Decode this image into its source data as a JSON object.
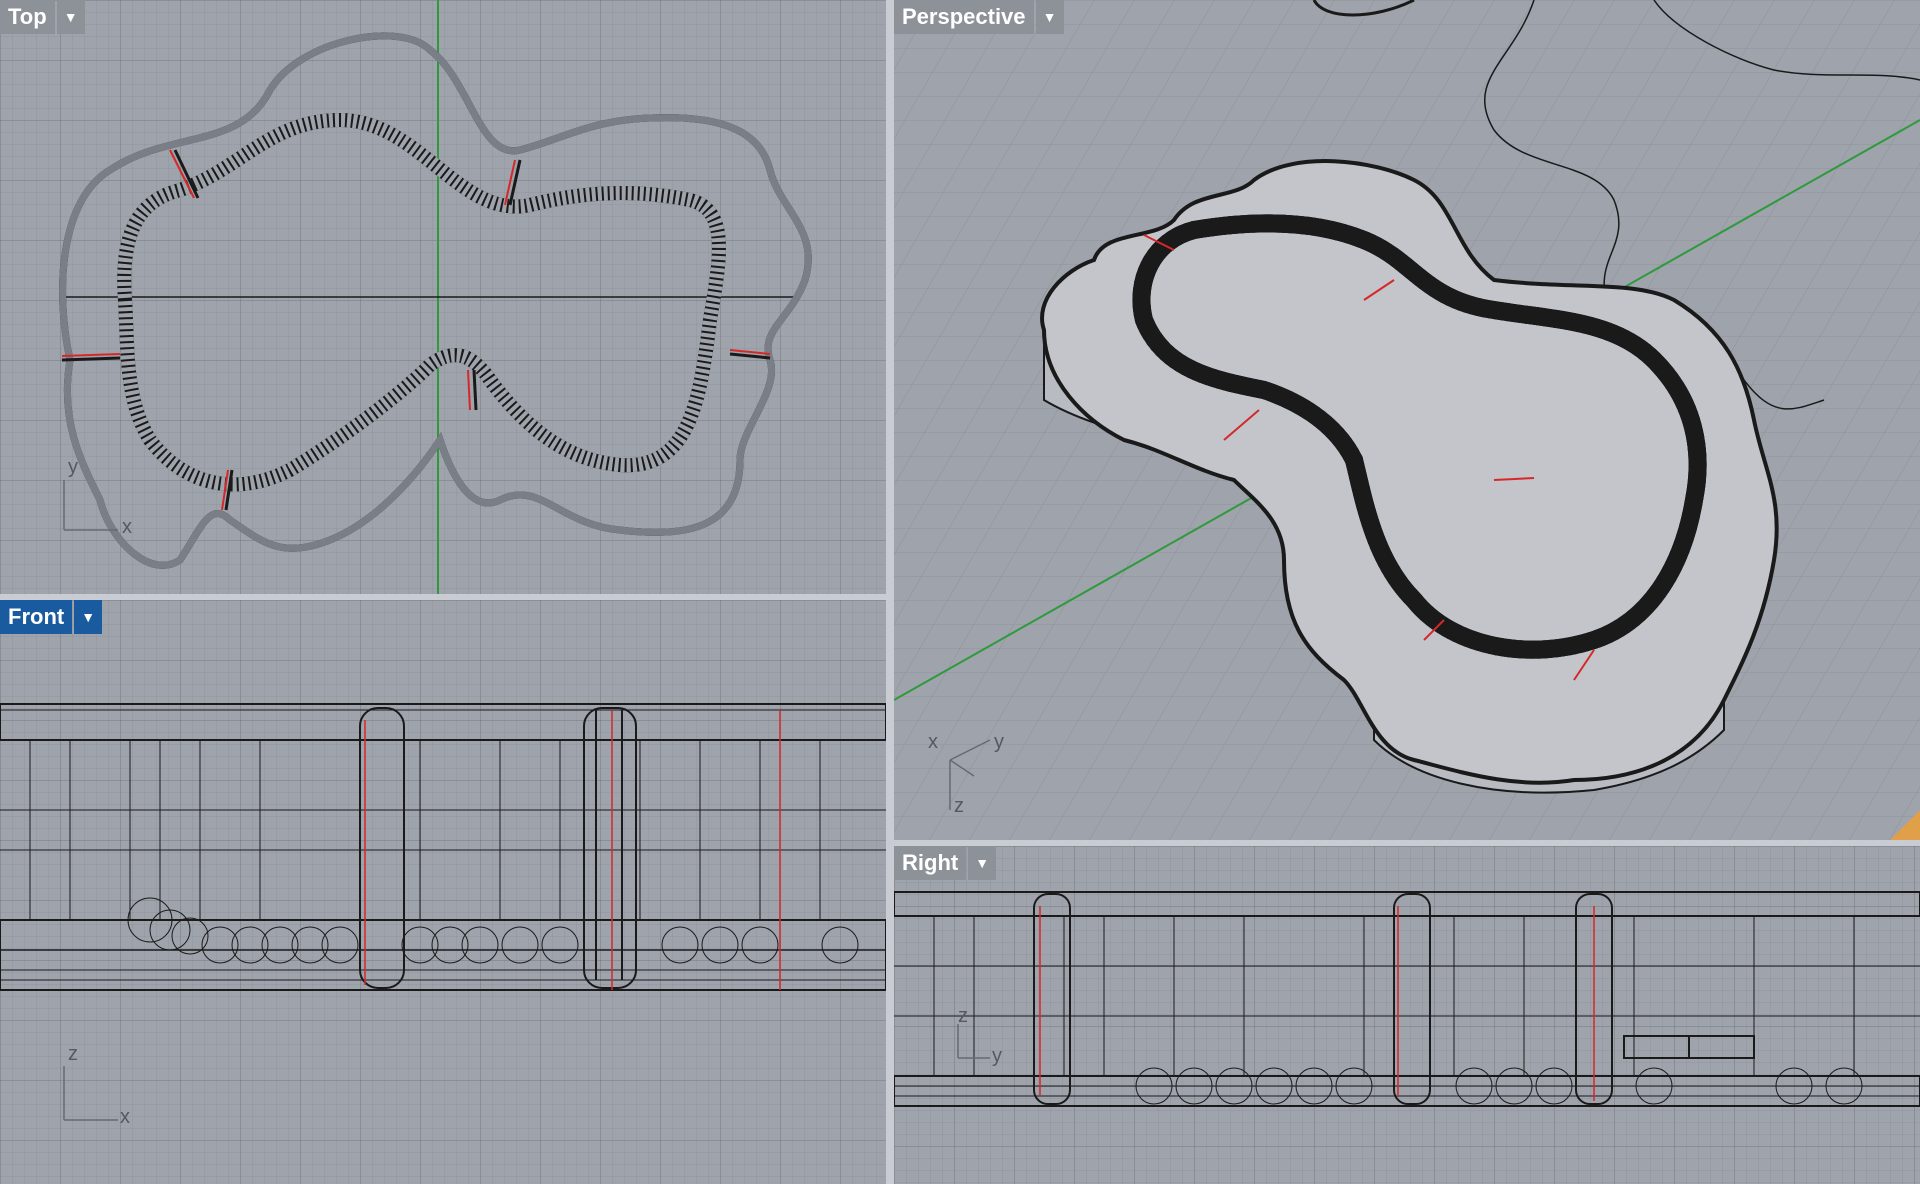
{
  "viewports": {
    "top": {
      "label": "Top",
      "menu_icon": "chevron-down-icon",
      "axes": [
        "y",
        "x"
      ]
    },
    "perspective": {
      "label": "Perspective",
      "menu_icon": "chevron-down-icon",
      "axes": [
        "x",
        "y",
        "z"
      ]
    },
    "front": {
      "label": "Front",
      "menu_icon": "chevron-down-icon",
      "axes": [
        "z",
        "x"
      ],
      "active": true
    },
    "right": {
      "label": "Right",
      "menu_icon": "chevron-down-icon",
      "axes": [
        "z",
        "y"
      ]
    }
  },
  "colors": {
    "viewport_bg": "#9ea3ac",
    "active_label": "#1a5a9e",
    "inactive_label": "#8d9198",
    "y_axis": "#2e9a3c",
    "x_axis": "#1a1a1a",
    "highlight_red": "#d62828",
    "surface": "#c3c5ca"
  }
}
